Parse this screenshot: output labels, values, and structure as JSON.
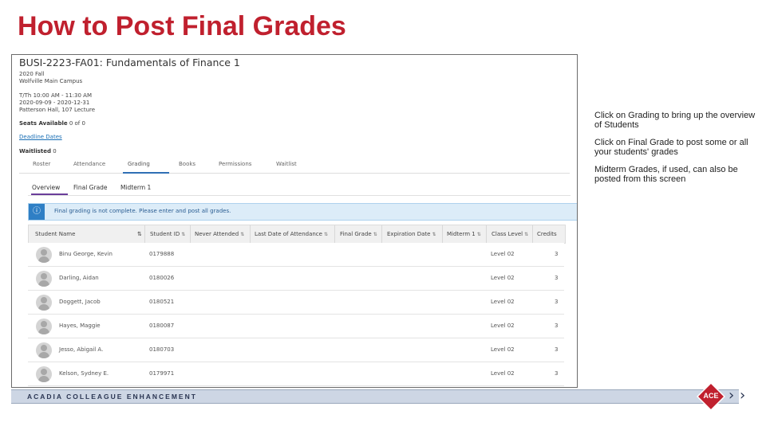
{
  "slide": {
    "title": "How to Post Final Grades",
    "notes": [
      "Click on Grading to bring up the overview of Students",
      "Click on Final Grade to post some or all your students' grades",
      "Midterm Grades, if used, can also be posted from this screen"
    ],
    "footer": "ACADIA COLLEAGUE ENHANCEMENT",
    "logo_text": "ACE",
    "colors": {
      "title": "#c0202e",
      "accent": "#2f6fb5",
      "logo": "#c0202e"
    }
  },
  "course": {
    "title": "BUSI-2223-FA01: Fundamentals of Finance 1",
    "term": "2020 Fall",
    "campus": "Wolfville Main Campus",
    "schedule": "T/Th 10:00 AM - 11:30 AM",
    "dates": "2020-09-09 - 2020-12-31",
    "location": "Patterson Hall, 107 Lecture",
    "seats_label": "Seats Available",
    "seats_value": "0 of 0",
    "deadline_link": "Deadline Dates",
    "waitlisted_label": "Waitlisted",
    "waitlisted_value": "0"
  },
  "tabs": [
    "Roster",
    "Attendance",
    "Grading",
    "Books",
    "Permissions",
    "Waitlist"
  ],
  "active_tab": "Grading",
  "subtabs": [
    "Overview",
    "Final Grade",
    "Midterm 1"
  ],
  "active_subtab": "Overview",
  "alert": {
    "icon": "info-icon",
    "text": "Final grading is not complete. Please enter and post all grades."
  },
  "table": {
    "columns": [
      "Student Name",
      "Student ID",
      "Never Attended",
      "Last Date of Attendance",
      "Final Grade",
      "Expiration Date",
      "Midterm 1",
      "Class Level",
      "Credits"
    ],
    "rows": [
      {
        "name": "Binu George, Kevin",
        "id": "0179888",
        "level": "Level 02",
        "credits": "3"
      },
      {
        "name": "Darling, Aidan",
        "id": "0180026",
        "level": "Level 02",
        "credits": "3"
      },
      {
        "name": "Doggett, Jacob",
        "id": "0180521",
        "level": "Level 02",
        "credits": "3"
      },
      {
        "name": "Hayes, Maggie",
        "id": "0180087",
        "level": "Level 02",
        "credits": "3"
      },
      {
        "name": "Jesso, Abigail A.",
        "id": "0180703",
        "level": "Level 02",
        "credits": "3"
      },
      {
        "name": "Kelson, Sydney E.",
        "id": "0179971",
        "level": "Level 02",
        "credits": "3"
      }
    ]
  }
}
